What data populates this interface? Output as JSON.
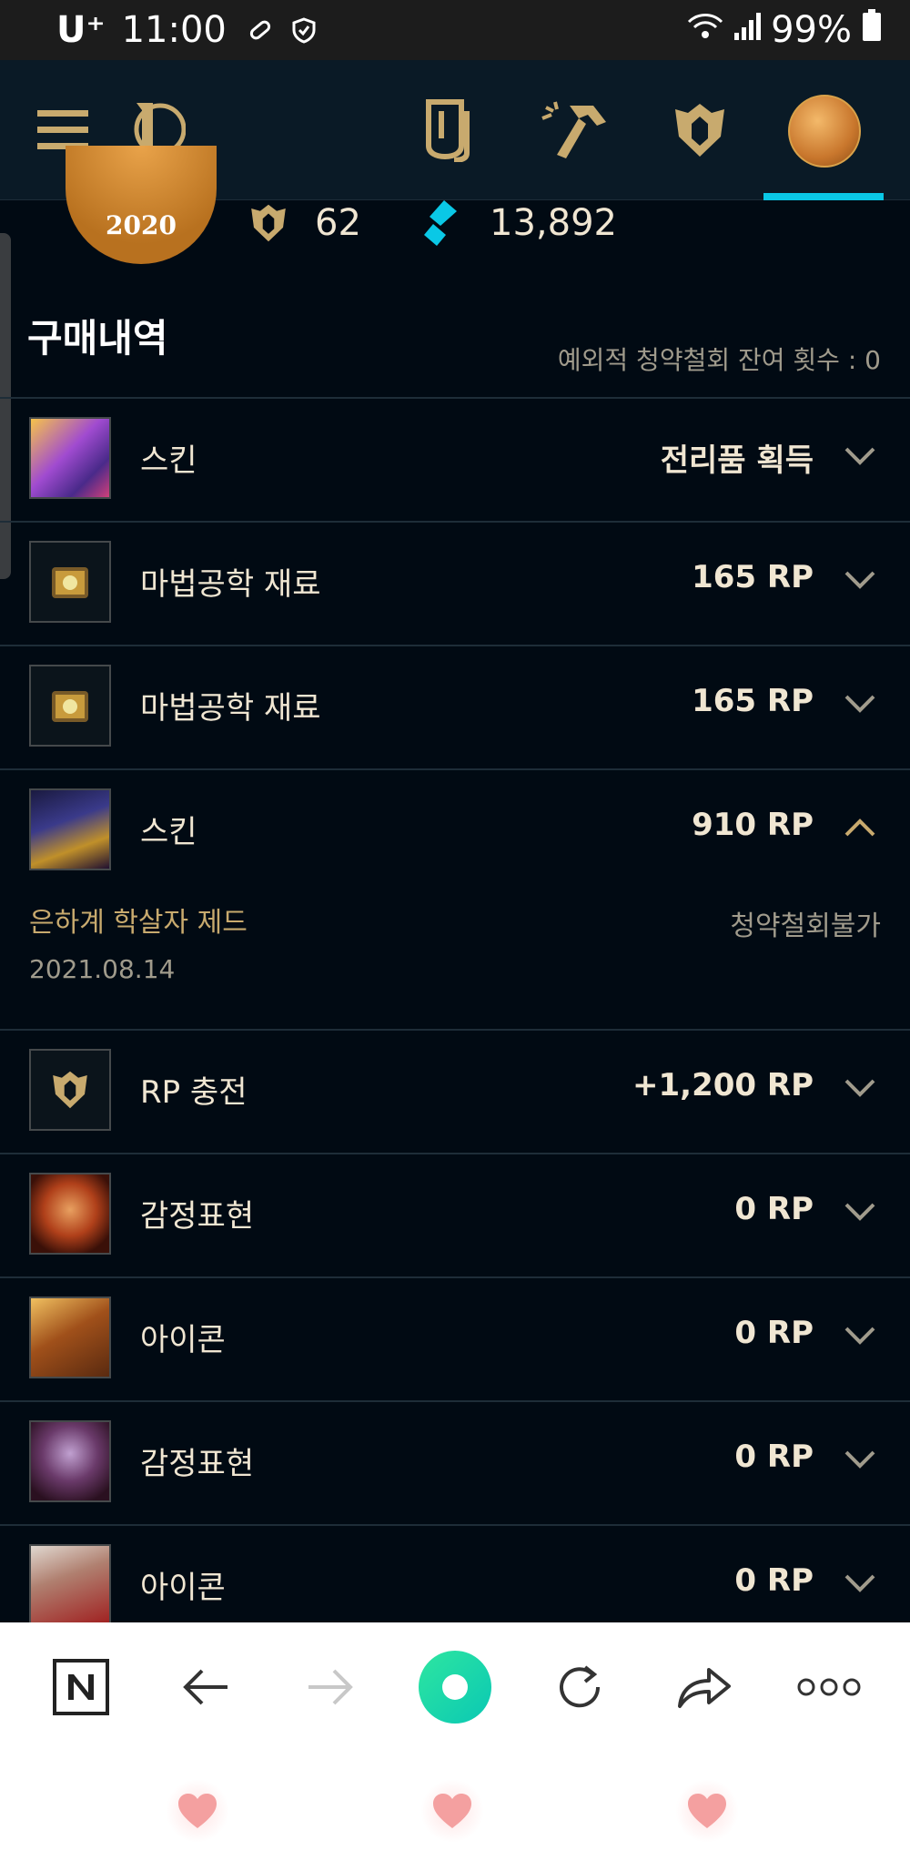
{
  "status_bar": {
    "carrier": "U⁺",
    "time": "11:00",
    "battery": "99%"
  },
  "nav": {
    "icons": [
      "menu-icon",
      "league-logo-icon",
      "collection-icon",
      "crafting-icon",
      "store-rp-icon",
      "profile-avatar"
    ],
    "active_tab": "profile-avatar",
    "accent": "#c8aa6e",
    "active_color": "#0ac8e6"
  },
  "profile": {
    "emblem_text": "2020",
    "rp_balance": "62",
    "blue_essence": "13,892"
  },
  "purchase_history": {
    "title": "구매내역",
    "refunds_label": "예외적 청약철회 잔여 횟수 : 0",
    "items": [
      {
        "label": "스킨",
        "price": "전리품 획득",
        "thumb": "skin-thumb-ezreal",
        "expanded": false
      },
      {
        "label": "마법공학 재료",
        "price": "165 RP",
        "thumb": "hextech-chest-thumb",
        "expanded": false
      },
      {
        "label": "마법공학 재료",
        "price": "165 RP",
        "thumb": "hextech-chest-thumb",
        "expanded": false
      },
      {
        "label": "스킨",
        "price": "910 RP",
        "thumb": "skin-thumb-zed",
        "expanded": true,
        "detail_name": "은하계 학살자 제드",
        "detail_note": "청약철회불가",
        "detail_date": "2021.08.14"
      },
      {
        "label": "RP 충전",
        "price": "+1,200 RP",
        "thumb": "rp-icon-thumb",
        "expanded": false
      },
      {
        "label": "감정표현",
        "price": "0 RP",
        "thumb": "emote-thumb",
        "expanded": false
      },
      {
        "label": "아이콘",
        "price": "0 RP",
        "thumb": "icon-thumb",
        "expanded": false
      },
      {
        "label": "감정표현",
        "price": "0 RP",
        "thumb": "emote-thumb-2",
        "expanded": false
      },
      {
        "label": "아이콘",
        "price": "0 RP",
        "thumb": "icon-thumb-2",
        "expanded": false
      }
    ]
  },
  "browser_bar": {
    "buttons": [
      "naver-home-button",
      "back-button",
      "forward-button",
      "green-dot-button",
      "reload-button",
      "share-button",
      "more-button"
    ]
  }
}
